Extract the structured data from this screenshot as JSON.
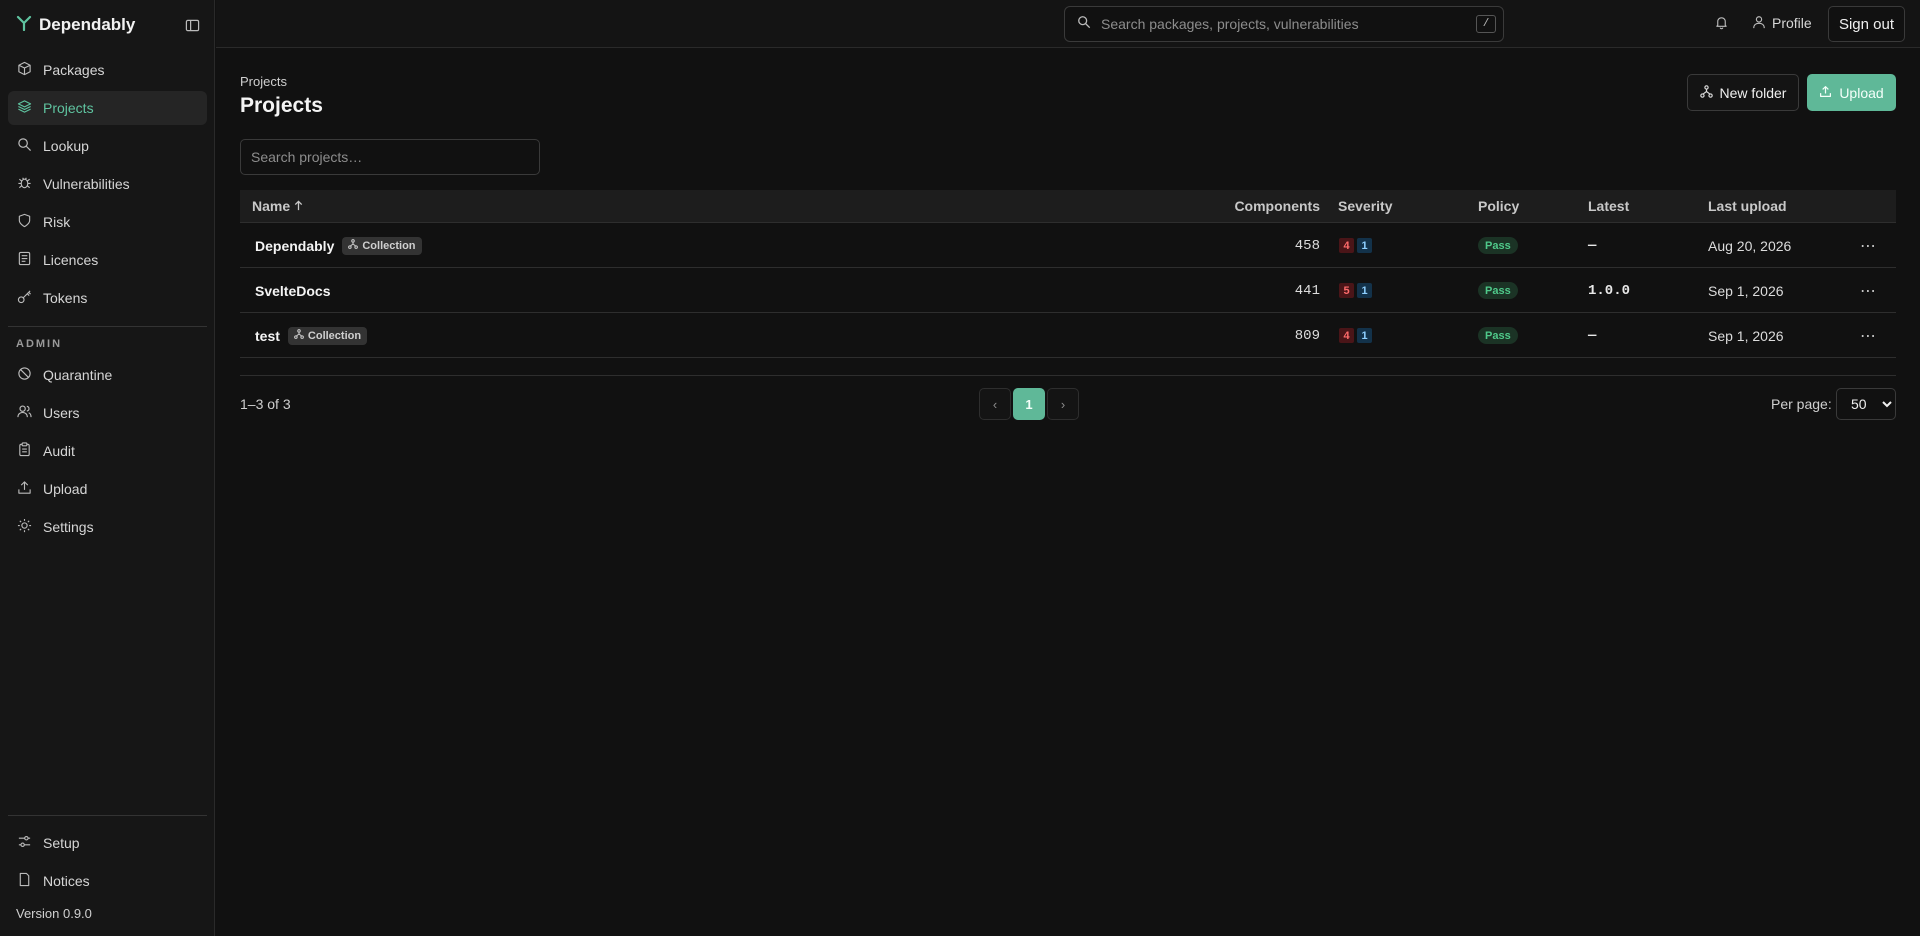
{
  "app": {
    "name": "Dependably",
    "version": "Version 0.9.0"
  },
  "sidebar": {
    "items": [
      {
        "label": "Packages",
        "icon": "package-icon"
      },
      {
        "label": "Projects",
        "icon": "layers-icon",
        "active": true
      },
      {
        "label": "Lookup",
        "icon": "search-icon"
      },
      {
        "label": "Vulnerabilities",
        "icon": "bug-icon"
      },
      {
        "label": "Risk",
        "icon": "shield-icon"
      },
      {
        "label": "Licences",
        "icon": "document-list-icon"
      },
      {
        "label": "Tokens",
        "icon": "key-icon"
      }
    ],
    "admin_section": "ADMIN",
    "admin_items": [
      {
        "label": "Quarantine",
        "icon": "ban-icon"
      },
      {
        "label": "Users",
        "icon": "users-icon"
      },
      {
        "label": "Audit",
        "icon": "clipboard-icon"
      },
      {
        "label": "Upload",
        "icon": "upload-icon"
      },
      {
        "label": "Settings",
        "icon": "sun-gear-icon"
      }
    ],
    "footer_items": [
      {
        "label": "Setup",
        "icon": "sliders-icon"
      },
      {
        "label": "Notices",
        "icon": "file-icon"
      }
    ]
  },
  "topbar": {
    "search_placeholder": "Search packages, projects, vulnerabilities",
    "search_shortcut": "/",
    "profile_label": "Profile",
    "signout_label": "Sign out"
  },
  "page": {
    "breadcrumb": "Projects",
    "title": "Projects",
    "new_folder_label": "New folder",
    "upload_label": "Upload",
    "search_placeholder": "Search projects…"
  },
  "table": {
    "columns": {
      "name": "Name",
      "components": "Components",
      "severity": "Severity",
      "policy": "Policy",
      "latest": "Latest",
      "last_upload": "Last upload"
    },
    "rows": [
      {
        "name": "Dependably",
        "chip": "Collection",
        "components": "458",
        "sev_high": "4",
        "sev_low": "1",
        "policy": "Pass",
        "latest": "—",
        "last_upload": "Aug 20, 2026"
      },
      {
        "name": "SvelteDocs",
        "chip": "",
        "components": "441",
        "sev_high": "5",
        "sev_low": "1",
        "policy": "Pass",
        "latest": "1.0.0",
        "last_upload": "Sep 1, 2026"
      },
      {
        "name": "test",
        "chip": "Collection",
        "components": "809",
        "sev_high": "4",
        "sev_low": "1",
        "policy": "Pass",
        "latest": "—",
        "last_upload": "Sep 1, 2026"
      }
    ]
  },
  "pagination": {
    "range": "1–3 of 3",
    "prev": "‹",
    "current": "1",
    "next": "›",
    "per_page_label": "Per page:",
    "per_page_value": "50"
  },
  "colors": {
    "accent": "#5fb898",
    "accent_text": "#5fc4a0",
    "danger": "#ff6b6b",
    "pass": "#4fc98a"
  }
}
